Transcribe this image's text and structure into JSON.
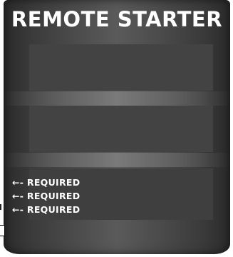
{
  "header": {
    "title": "REMOTE STARTER"
  },
  "form": {
    "required_markers": [
      "←- REQUIRED",
      "←- REQUIRED",
      "←- REQUIRED"
    ]
  },
  "colors": {
    "panel_dark": "#2a2a2a",
    "panel_light": "#5a5a5a",
    "field_bg": "#434343",
    "text": "#ffffff"
  }
}
